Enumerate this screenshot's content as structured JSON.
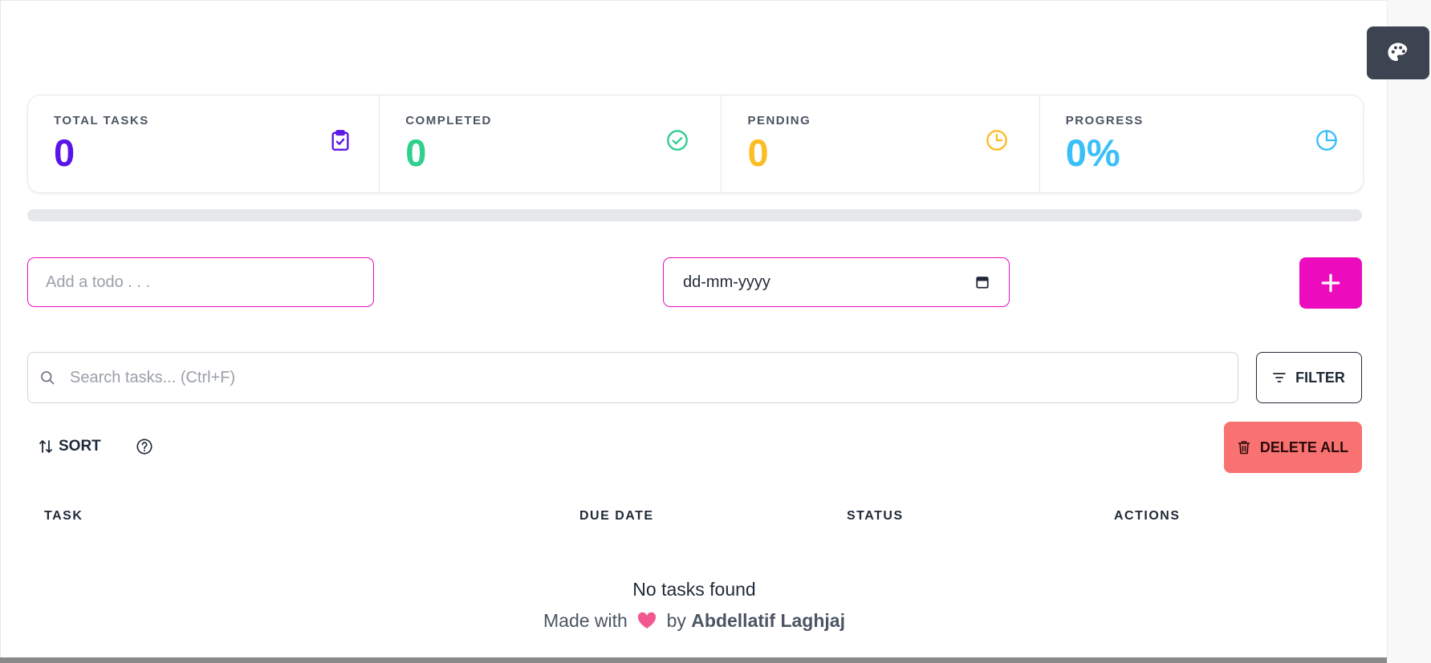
{
  "stats": {
    "total": {
      "label": "TOTAL TASKS",
      "value": "0",
      "color": "#5a14e6",
      "icon": "clipboard-check-icon"
    },
    "completed": {
      "label": "COMPLETED",
      "value": "0",
      "color": "#2fcf8e",
      "icon": "check-circle-icon"
    },
    "pending": {
      "label": "PENDING",
      "value": "0",
      "color": "#fbbd23",
      "icon": "clock-icon"
    },
    "progress": {
      "label": "PROGRESS",
      "value": "0%",
      "color": "#3abff8",
      "icon": "pie-chart-icon"
    }
  },
  "progress_fraction": 0,
  "form": {
    "todo_placeholder": "Add a todo . . .",
    "date_placeholder": "dd-mm-yyyy",
    "add_label": "+"
  },
  "search": {
    "placeholder": "Search tasks... (Ctrl+F)"
  },
  "filter": {
    "label": "FILTER"
  },
  "sort": {
    "label": "SORT"
  },
  "delete_all": {
    "label": "DELETE ALL"
  },
  "table": {
    "columns": [
      "TASK",
      "DUE DATE",
      "STATUS",
      "ACTIONS"
    ],
    "empty_message": "No tasks found"
  },
  "footer": {
    "made_with": "Made with",
    "by": "by",
    "author": "Abdellatif Laghjaj"
  },
  "colors": {
    "accent": "#ec0bbd",
    "error": "#f87272",
    "theme_button": "#3d4451"
  }
}
